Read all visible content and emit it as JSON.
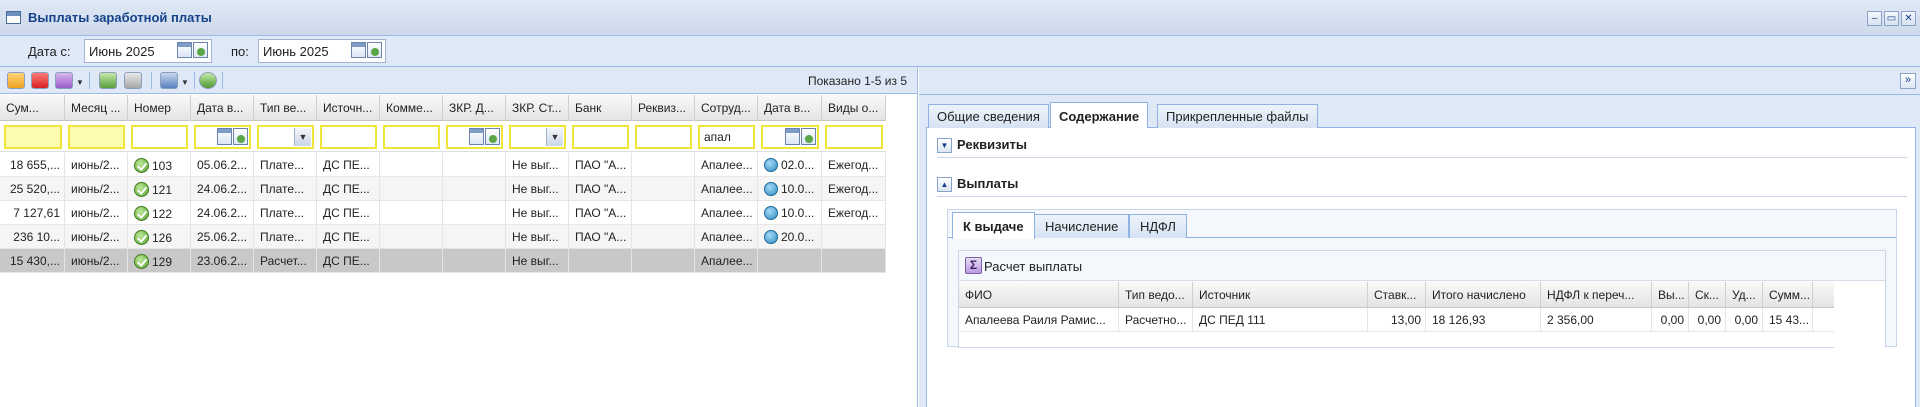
{
  "window": {
    "title": "Выплаты заработной платы",
    "controls": [
      "‒",
      "▭",
      "✕"
    ]
  },
  "filter": {
    "from_label": "Дата с:",
    "from_value": "Июнь 2025",
    "to_label": "по:",
    "to_value": "Июнь 2025"
  },
  "toolbar": {
    "shown_text": "Показано 1-5 из 5"
  },
  "grid": {
    "headers": [
      "Сум...",
      "Месяц ...",
      "Номер",
      "Дата в...",
      "Тип ве...",
      "Источн...",
      "Комме...",
      "ЗКР. Д...",
      "ЗКР. Ст...",
      "Банк",
      "Реквиз...",
      "Сотруд...",
      "Дата в...",
      "Виды о..."
    ],
    "filter_employee": "апал",
    "rows": [
      {
        "sum": "18 655,...",
        "month": "июнь/2...",
        "number": "103",
        "date": "05.06.2...",
        "type": "Плате...",
        "source": "ДС ПЕ...",
        "comment": "",
        "zkr_d": "",
        "zkr_st": "Не выг...",
        "bank": "ПАО \"А...",
        "req": "",
        "employee": "Апалее...",
        "pay_date": "02.0...",
        "kinds": "Ежегод..."
      },
      {
        "sum": "25 520,...",
        "month": "июнь/2...",
        "number": "121",
        "date": "24.06.2...",
        "type": "Плате...",
        "source": "ДС ПЕ...",
        "comment": "",
        "zkr_d": "",
        "zkr_st": "Не выг...",
        "bank": "ПАО \"А...",
        "req": "",
        "employee": "Апалее...",
        "pay_date": "10.0...",
        "kinds": "Ежегод..."
      },
      {
        "sum": "7 127,61",
        "month": "июнь/2...",
        "number": "122",
        "date": "24.06.2...",
        "type": "Плате...",
        "source": "ДС ПЕ...",
        "comment": "",
        "zkr_d": "",
        "zkr_st": "Не выг...",
        "bank": "ПАО \"А...",
        "req": "",
        "employee": "Апалее...",
        "pay_date": "10.0...",
        "kinds": "Ежегод..."
      },
      {
        "sum": "236 10...",
        "month": "июнь/2...",
        "number": "126",
        "date": "25.06.2...",
        "type": "Плате...",
        "source": "ДС ПЕ...",
        "comment": "",
        "zkr_d": "",
        "zkr_st": "Не выг...",
        "bank": "ПАО \"А...",
        "req": "",
        "employee": "Апалее...",
        "pay_date": "20.0...",
        "kinds": ""
      },
      {
        "sum": "15 430,...",
        "month": "июнь/2...",
        "number": "129",
        "date": "23.06.2...",
        "type": "Расчет...",
        "source": "ДС ПЕ...",
        "comment": "",
        "zkr_d": "",
        "zkr_st": "Не выг...",
        "bank": "",
        "req": "",
        "employee": "Апалее...",
        "pay_date": "",
        "kinds": ""
      }
    ]
  },
  "right": {
    "expand": "»",
    "tabs": [
      "Общие сведения",
      "Содержание",
      "Прикрепленные файлы"
    ],
    "sections": {
      "requisites": "Реквизиты",
      "payments": "Выплаты"
    },
    "inner_tabs": [
      "К выдаче",
      "Начисление",
      "НДФЛ"
    ],
    "calc_label": "Расчет выплаты",
    "calc_headers": [
      "ФИО",
      "Тип ведо...",
      "Источник",
      "Ставк...",
      "Итого начислено",
      "НДФЛ к переч...",
      "Вы...",
      "Ск...",
      "Уд...",
      "Сумм..."
    ],
    "calc_row": [
      "Апалеева Раиля Рамис...",
      "Расчетно...",
      "ДС ПЕД 111",
      "13,00",
      "18 126,93",
      "2 356,00",
      "0,00",
      "0,00",
      "0,00",
      "15 43..."
    ]
  },
  "colors": {
    "accent": "#15428b",
    "panel": "#dfe8f6",
    "filter_highlight": "#f0e53a"
  }
}
